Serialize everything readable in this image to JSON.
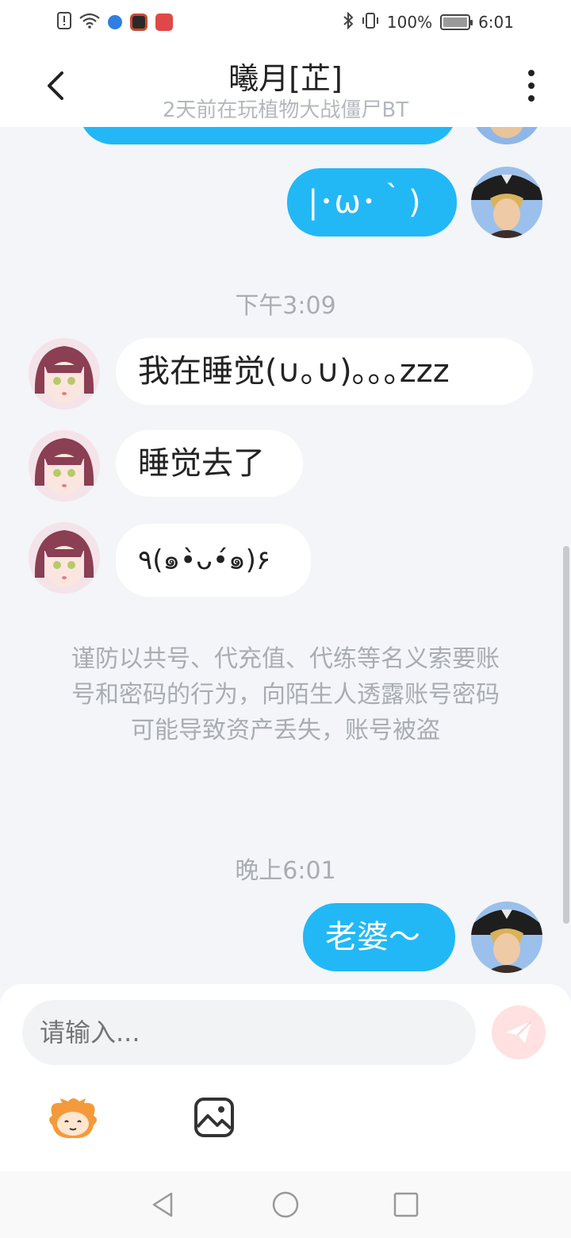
{
  "status_bar": {
    "battery_percent": "100%",
    "time": "6:01",
    "icons": [
      "alert-icon",
      "wifi-icon",
      "app-icon",
      "app-icon",
      "app-icon",
      "bluetooth-icon",
      "vibrate-icon",
      "battery-icon"
    ]
  },
  "header": {
    "title": "曦月[芷]",
    "subtitle": "2天前在玩植物大战僵尸BT"
  },
  "messages": {
    "m1": "|･ω･｀)",
    "ts1": "下午3:09",
    "m2": "我在睡觉(∪｡∪)｡｡｡zzz",
    "m3": "睡觉去了",
    "m4": "٩(๑•̀ᴗ•́๑)۶",
    "warning": "谨防以共号、代充值、代练等名义索要账号和密码的行为，向陌生人透露账号密码可能导致资产丢失，账号被盗",
    "ts2": "晚上6:01",
    "m5": "老婆～"
  },
  "input": {
    "placeholder": "请输入..."
  },
  "colors": {
    "outgoing_bubble": "#22b8f6",
    "incoming_bubble": "#ffffff",
    "background": "#f3f5f8",
    "send_button": "#ffe1e1"
  }
}
